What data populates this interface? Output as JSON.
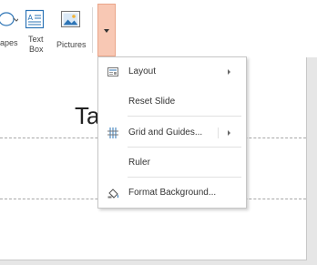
{
  "ribbon": {
    "shapes_label": "apes",
    "textbox_label_line1": "Text",
    "textbox_label_line2": "Box",
    "pictures_label": "Pictures"
  },
  "slide": {
    "title_fragment": "Ta"
  },
  "context_menu": {
    "items": [
      {
        "label": "Layout",
        "icon": "layout-icon",
        "has_submenu": true
      },
      {
        "label": "Reset Slide",
        "icon": null,
        "has_submenu": false
      },
      {
        "label": "Grid and Guides...",
        "icon": "grid-icon",
        "has_submenu": true
      },
      {
        "label": "Ruler",
        "icon": null,
        "has_submenu": false
      },
      {
        "label": "Format Background...",
        "icon": "format-background-icon",
        "has_submenu": false
      }
    ]
  },
  "colors": {
    "dropdown_highlight": "#f8c8b4",
    "dropdown_border": "#eaa68a",
    "icon_blue": "#2e75b6"
  }
}
